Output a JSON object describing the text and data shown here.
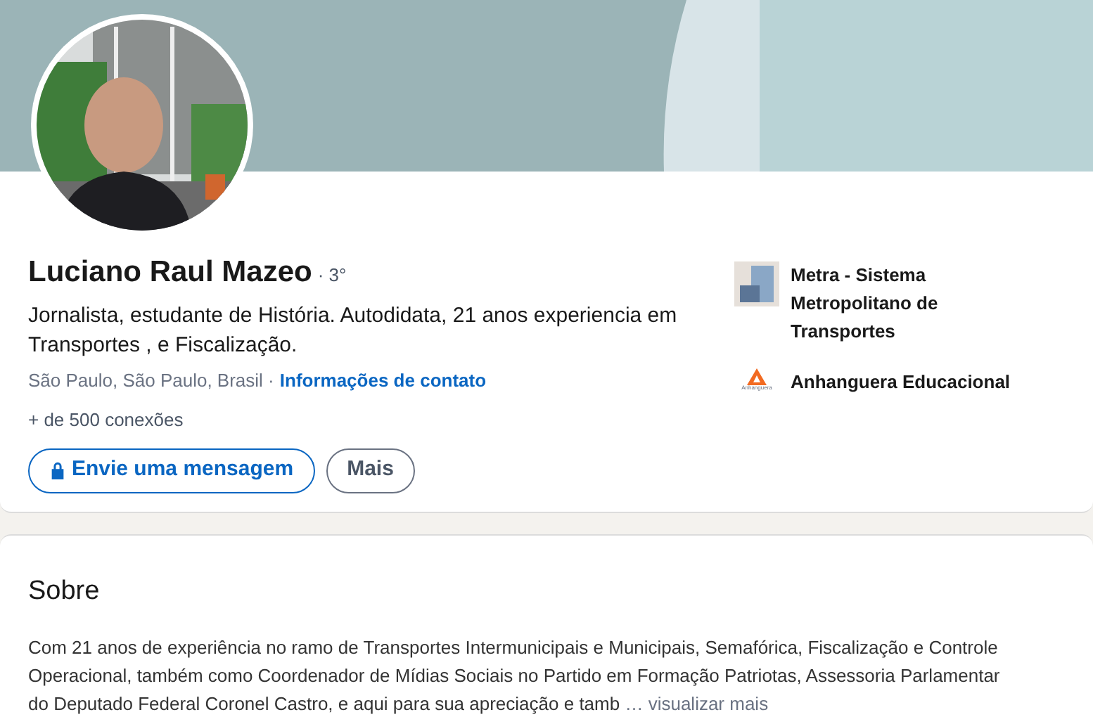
{
  "profile": {
    "name": "Luciano Raul Mazeo",
    "degree": "· 3°",
    "headline": "Jornalista, estudante de História. Autodidata, 21 anos experiencia em Transportes , e Fiscalização.",
    "location": "São Paulo, São Paulo, Brasil ·",
    "contact_link": "Informações de contato",
    "connections": "+ de 500 conexões",
    "buttons": [
      {
        "kind": "primary",
        "label": "Envie uma mensagem"
      },
      {
        "kind": "secondary",
        "label": "Mais"
      }
    ],
    "organizations": [
      {
        "kind": "company",
        "name": "Metra - Sistema Metropolitano de Transportes"
      },
      {
        "kind": "school",
        "name": "Anhanguera Educacional",
        "logo_text": "Anhanguera"
      }
    ]
  },
  "about": {
    "title": "Sobre",
    "text": "Com 21 anos de experiência no ramo de Transportes Intermunicipais e Municipais, Semafórica, Fiscalização e Controle Operacional, também como Coordenador de Mídias Sociais no Partido em Formação Patriotas, Assessoria Parlamentar do Deputado Federal Coronel Castro, e aqui para sua apreciação e tamb",
    "more": "… visualizar mais"
  }
}
